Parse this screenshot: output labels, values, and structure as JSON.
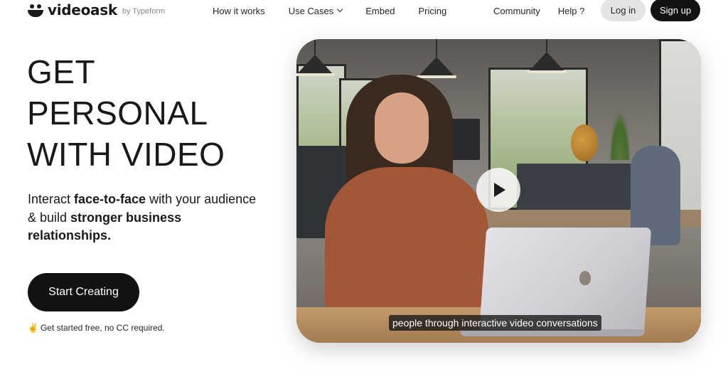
{
  "brand": {
    "name": "videoask",
    "byline": "by Typeform",
    "logo_icon": "smiley-face-icon"
  },
  "nav": {
    "left": [
      {
        "label": "How it works"
      },
      {
        "label": "Use Cases",
        "has_dropdown": true,
        "icon": "chevron-down-icon"
      },
      {
        "label": "Embed"
      },
      {
        "label": "Pricing"
      }
    ],
    "right": [
      {
        "label": "Community"
      },
      {
        "label": "Help ?"
      }
    ],
    "login_label": "Log in",
    "signup_label": "Sign up"
  },
  "hero": {
    "headline_lines": [
      "GET",
      "PERSONAL",
      "WITH VIDEO"
    ],
    "subtext": {
      "part1": "Interact ",
      "bold1": "face-to-face",
      "part2": " with your audience & build ",
      "bold2": "stronger business relationships."
    },
    "cta_label": "Start Creating",
    "note_icon": "✌",
    "note_text": "Get started free, no CC required."
  },
  "video": {
    "caption": "people through interactive video conversations",
    "play_icon": "play-icon"
  },
  "colors": {
    "primary_dark": "#121212",
    "login_bg": "#e3e3e3",
    "text": "#191919",
    "byline": "#8a8a8a"
  }
}
